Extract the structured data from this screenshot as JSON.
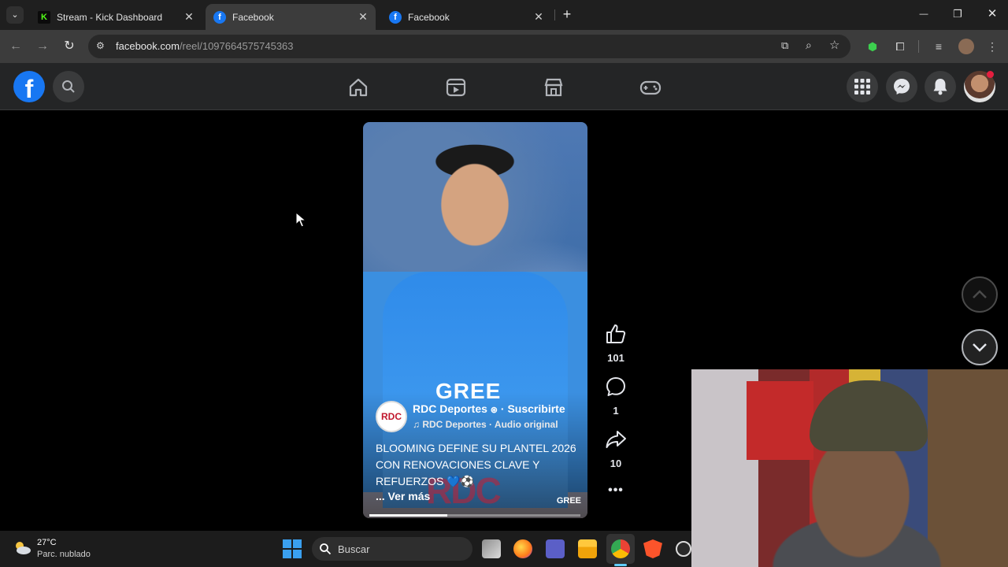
{
  "browser": {
    "tabs": [
      {
        "title": "Stream - Kick Dashboard",
        "favicon": "K",
        "favicon_color": "#53fc18",
        "active": false
      },
      {
        "title": "Facebook",
        "favicon": "f",
        "favicon_color": "#1877f2",
        "active": true
      },
      {
        "title": "Facebook",
        "favicon": "f",
        "favicon_color": "#1877f2",
        "active": false
      }
    ],
    "new_tab": "+",
    "window_controls": {
      "minimize": "—",
      "restore": "❐",
      "close": "✕"
    },
    "url_host": "facebook.com",
    "url_path": "/reel/1097664575745363"
  },
  "facebook": {
    "logo": "f",
    "nav": [
      "home-icon",
      "video-icon",
      "marketplace-icon",
      "gaming-icon"
    ],
    "right": [
      "menu-grid-icon",
      "messenger-icon",
      "notifications-icon",
      "profile-avatar"
    ]
  },
  "reel": {
    "author": "RDC Deportes",
    "subscribe": "Suscribirte",
    "audio": "RDC Deportes · Audio original",
    "caption": "BLOOMING DEFINE SU PLANTEL 2026 CON RENOVACIONES CLAVE Y REFUERZOS 💙⚽",
    "more": "... Ver más",
    "avatar_text": "RDC",
    "progress": 0.37,
    "sponsor": "GREE",
    "watermark": "RDC"
  },
  "actions": {
    "likes": "101",
    "comments": "1",
    "shares": "10",
    "more": "•••"
  },
  "taskbar": {
    "temperature": "27°C",
    "weather": "Parc. nublado",
    "search_placeholder": "Buscar"
  },
  "colors": {
    "accent": "#1877f2",
    "fb_bar": "#242526",
    "tab_strip": "#1f1f1f"
  }
}
